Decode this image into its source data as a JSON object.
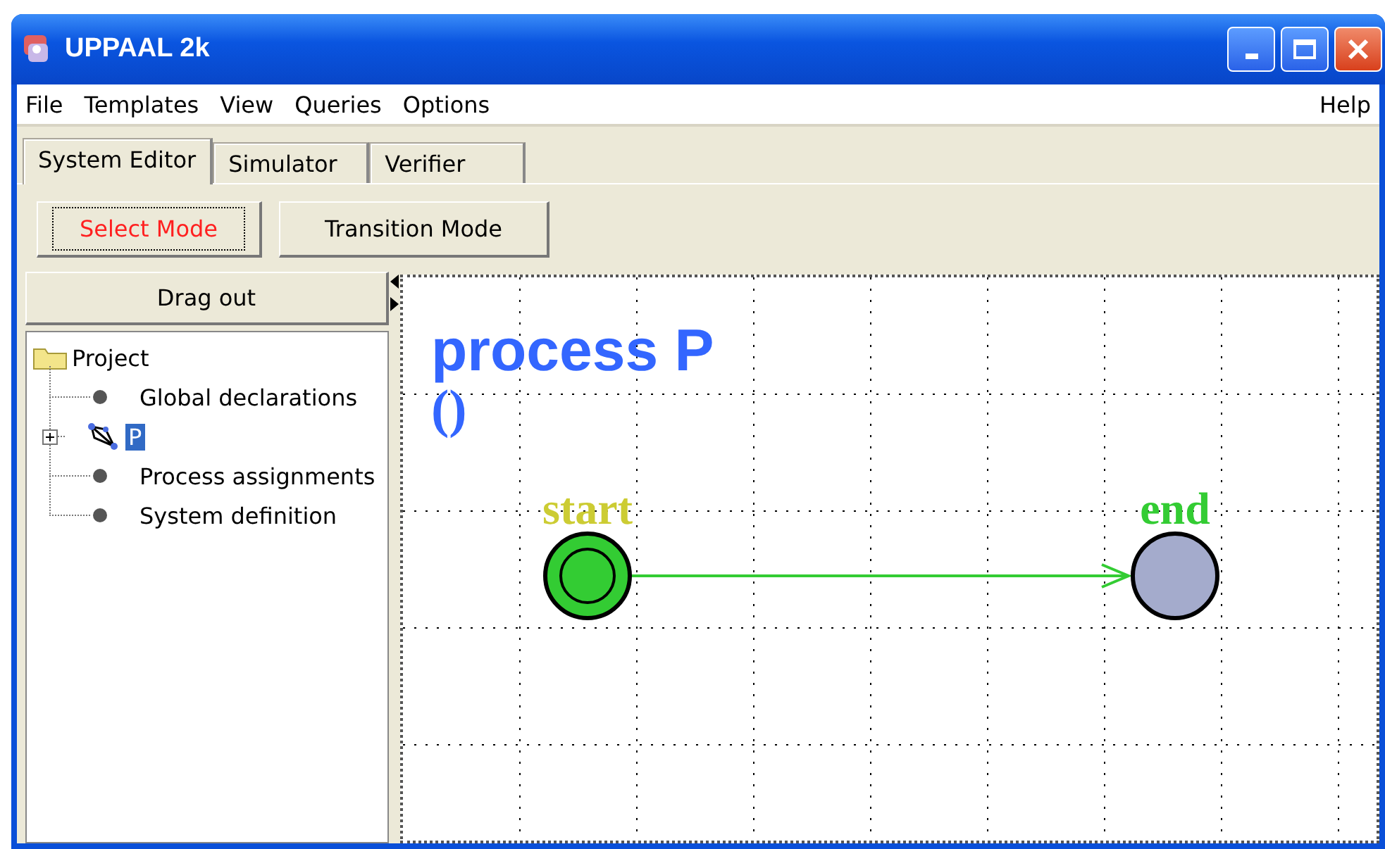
{
  "window": {
    "title": "UPPAAL 2k"
  },
  "menu": [
    "File",
    "Templates",
    "View",
    "Queries",
    "Options"
  ],
  "help_menu": "Help",
  "tabs": [
    {
      "label": "System Editor",
      "selected": true
    },
    {
      "label": "Simulator",
      "selected": false
    },
    {
      "label": "Verifier",
      "selected": false
    }
  ],
  "mode_buttons": [
    {
      "label": "Select Mode",
      "selected": true
    },
    {
      "label": "Transition Mode",
      "selected": false
    }
  ],
  "drag_out": "Drag out",
  "tree": {
    "label": "Project",
    "kind": "folder",
    "children": [
      {
        "label": "Global declarations",
        "kind": "leaf",
        "selected": false
      },
      {
        "label": "P",
        "kind": "template",
        "selected": true,
        "expanded": false
      },
      {
        "label": "Process assignments",
        "kind": "leaf",
        "selected": false
      },
      {
        "label": "System definition",
        "kind": "leaf",
        "selected": false
      }
    ]
  },
  "canvas": {
    "title": "process P",
    "params": "()",
    "locations": [
      {
        "name": "start",
        "kind": "initial",
        "color": "#cccc33"
      },
      {
        "name": "end",
        "kind": "normal",
        "color": "#33cc33"
      }
    ]
  }
}
